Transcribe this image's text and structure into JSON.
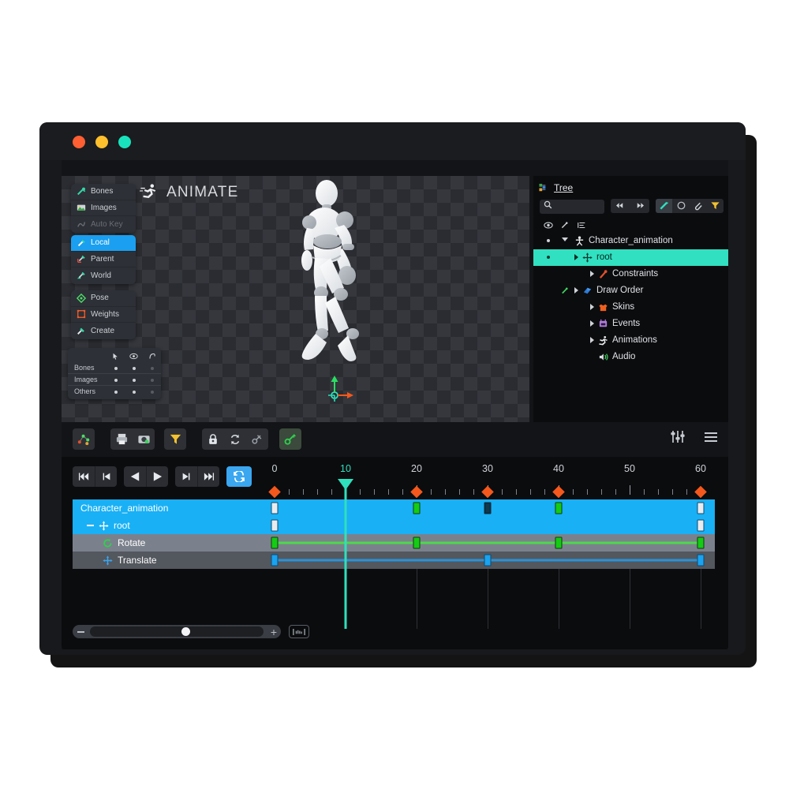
{
  "window": {
    "traffic_lights": [
      "close",
      "minimize",
      "zoom"
    ],
    "colors": {
      "close": "#ff5f32",
      "minimize": "#ffc02e",
      "zoom": "#19e3bd"
    }
  },
  "viewport": {
    "mode_badge": "ANIMATE",
    "mode_icon": "runner-icon",
    "tool_panels": [
      {
        "items": [
          {
            "label": "Bones",
            "icon": "bone-icon",
            "state": "normal"
          },
          {
            "label": "Images",
            "icon": "image-icon",
            "state": "normal"
          },
          {
            "label": "Auto Key",
            "icon": "autokey-icon",
            "state": "disabled"
          }
        ]
      },
      {
        "items": [
          {
            "label": "Local",
            "icon": "axis-local-icon",
            "state": "selected"
          },
          {
            "label": "Parent",
            "icon": "axis-parent-icon",
            "state": "normal"
          },
          {
            "label": "World",
            "icon": "axis-world-icon",
            "state": "normal"
          }
        ]
      },
      {
        "items": [
          {
            "label": "Pose",
            "icon": "pose-icon",
            "state": "normal"
          },
          {
            "label": "Weights",
            "icon": "weights-icon",
            "state": "normal"
          },
          {
            "label": "Create",
            "icon": "create-icon",
            "state": "normal"
          }
        ]
      }
    ],
    "visibility_panel": {
      "column_icons": [
        "cursor-icon",
        "eye-icon",
        "ghost-icon"
      ],
      "rows": [
        {
          "label": "Bones",
          "dots": [
            "on",
            "on",
            "off"
          ]
        },
        {
          "label": "Images",
          "dots": [
            "on",
            "on",
            "off"
          ]
        },
        {
          "label": "Others",
          "dots": [
            "on",
            "on",
            "off"
          ]
        }
      ]
    }
  },
  "tree": {
    "title": "Tree",
    "title_icon": "tree-icon",
    "search": {
      "placeholder": "",
      "value": "",
      "icon": "search-icon"
    },
    "nav_buttons": [
      {
        "name": "back-button",
        "icon": "arrow-left-icon"
      },
      {
        "name": "forward-button",
        "icon": "arrow-right-icon"
      }
    ],
    "filter_buttons": [
      {
        "name": "bones-filter",
        "icon": "bone-filter-icon",
        "active": true
      },
      {
        "name": "circle-filter",
        "icon": "circle-icon",
        "active": false
      },
      {
        "name": "attachment-filter",
        "icon": "paperclip-icon",
        "active": false
      },
      {
        "name": "funnel-filter",
        "icon": "funnel-icon",
        "active": false
      }
    ],
    "column_headers": [
      "eye-icon",
      "link-icon",
      "list-icon"
    ],
    "nodes": [
      {
        "label": "Character_animation",
        "icon": "skeleton-icon",
        "depth": 0,
        "expander": "down",
        "selected": false,
        "dot": true,
        "link": false
      },
      {
        "label": "root",
        "icon": "move-icon",
        "depth": 1,
        "expander": "right",
        "selected": true,
        "dot": true,
        "link": false
      },
      {
        "label": "Constraints",
        "icon": "constraint-icon",
        "depth": 2,
        "expander": "right",
        "selected": false,
        "dot": false,
        "link": false
      },
      {
        "label": "Draw Order",
        "icon": "draworder-icon",
        "depth": 2,
        "expander": "right",
        "selected": false,
        "dot": false,
        "link": true
      },
      {
        "label": "Skins",
        "icon": "skin-icon",
        "depth": 2,
        "expander": "right",
        "selected": false,
        "dot": false,
        "link": false
      },
      {
        "label": "Events",
        "icon": "event-icon",
        "depth": 2,
        "expander": "right",
        "selected": false,
        "dot": false,
        "link": false
      },
      {
        "label": "Animations",
        "icon": "animations-icon",
        "depth": 2,
        "expander": "right",
        "selected": false,
        "dot": false,
        "link": false
      },
      {
        "label": "Audio",
        "icon": "audio-icon",
        "depth": 2,
        "expander": "none",
        "selected": false,
        "dot": false,
        "link": false
      }
    ]
  },
  "midbar": {
    "left_groups": [
      {
        "buttons": [
          {
            "name": "graph-button",
            "icon": "graph-icon",
            "active": false
          }
        ]
      },
      {
        "buttons": [
          {
            "name": "print-button",
            "icon": "print-icon",
            "active": false
          },
          {
            "name": "camera-button",
            "icon": "camera-icon",
            "active": false
          }
        ]
      },
      {
        "buttons": [
          {
            "name": "filter-button",
            "icon": "funnel-icon",
            "active": false
          }
        ]
      },
      {
        "buttons": [
          {
            "name": "lock-button",
            "icon": "lock-icon",
            "active": false
          },
          {
            "name": "refresh-button",
            "icon": "refresh-icon",
            "active": false
          },
          {
            "name": "nokey-button",
            "icon": "key-off-icon",
            "active": false
          }
        ]
      },
      {
        "buttons": [
          {
            "name": "key-button",
            "icon": "key-icon",
            "active": true
          }
        ]
      }
    ],
    "right_buttons": [
      {
        "name": "settings-sliders-button",
        "icon": "sliders-icon"
      },
      {
        "name": "menu-button",
        "icon": "hamburger-icon"
      }
    ]
  },
  "timeline": {
    "transport": [
      {
        "name": "skip-start-button",
        "icon": "skip-start-icon"
      },
      {
        "name": "step-back-button",
        "icon": "step-back-icon"
      },
      {
        "name": "play-reverse-button",
        "icon": "play-reverse-icon"
      },
      {
        "name": "play-button",
        "icon": "play-icon"
      },
      {
        "name": "step-forward-button",
        "icon": "step-forward-icon"
      },
      {
        "name": "skip-end-button",
        "icon": "skip-end-icon"
      },
      {
        "name": "loop-button",
        "icon": "loop-icon",
        "active": true
      }
    ],
    "ruler": {
      "labels": [
        0,
        10,
        20,
        30,
        40,
        50,
        60
      ],
      "current_frame": 10,
      "frame_min": 0,
      "frame_max": 60,
      "keyframe_markers": [
        0,
        20,
        30,
        40,
        60
      ]
    },
    "rows": [
      {
        "label": "Character_animation",
        "icon": "none",
        "depth": 0,
        "type": "animation",
        "expander": "none",
        "keys": [
          {
            "frame": 0,
            "style": "white"
          },
          {
            "frame": 20,
            "style": "green"
          },
          {
            "frame": 30,
            "style": "hollow"
          },
          {
            "frame": 40,
            "style": "green"
          },
          {
            "frame": 60,
            "style": "white"
          }
        ]
      },
      {
        "label": "root",
        "icon": "move-icon",
        "depth": 1,
        "type": "bone",
        "expander": "minus",
        "keys": [
          {
            "frame": 0,
            "style": "white"
          },
          {
            "frame": 60,
            "style": "white"
          }
        ]
      },
      {
        "label": "Rotate",
        "icon": "rotate-icon",
        "depth": 2,
        "type": "property",
        "expander": "none",
        "curve_color": "#4dd94d",
        "keys": [
          {
            "frame": 0,
            "style": "green"
          },
          {
            "frame": 20,
            "style": "green"
          },
          {
            "frame": 40,
            "style": "green"
          },
          {
            "frame": 60,
            "style": "green"
          }
        ]
      },
      {
        "label": "Translate",
        "icon": "move-icon",
        "depth": 2,
        "type": "property",
        "expander": "none",
        "curve_color": "#2a93d8",
        "keys": [
          {
            "frame": 0,
            "style": "blue"
          },
          {
            "frame": 30,
            "style": "blue"
          },
          {
            "frame": 60,
            "style": "blue"
          }
        ]
      }
    ],
    "zoom_bar": {
      "minus_label": "–",
      "plus_label": "+",
      "value_percent": 50,
      "fit_button": "fit-icon"
    }
  }
}
